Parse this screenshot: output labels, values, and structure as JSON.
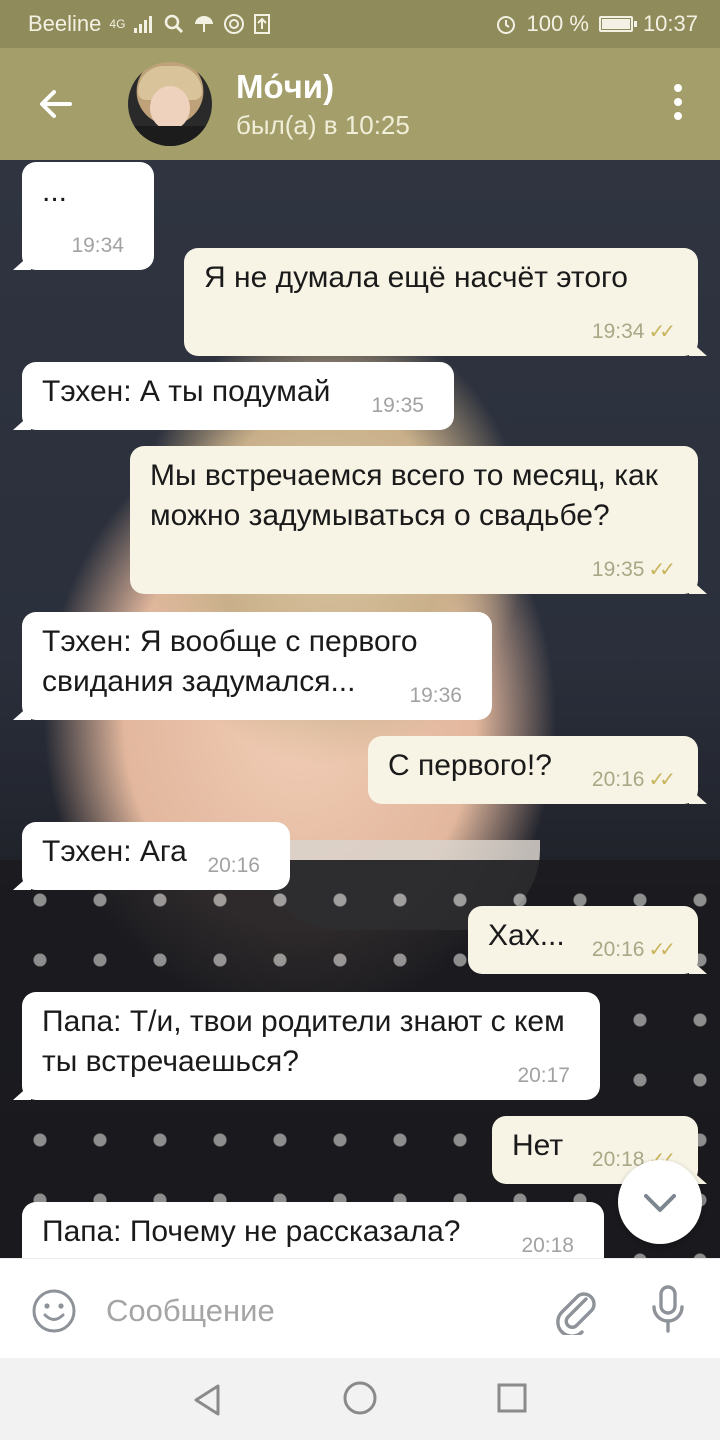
{
  "status_bar": {
    "carrier": "Beeline",
    "network": "4G",
    "battery_percent": "100 %",
    "time": "10:37",
    "icons": [
      "signal-icon",
      "search-icon",
      "umbrella-icon",
      "at-icon",
      "upload-icon",
      "alarm-icon",
      "battery-icon"
    ]
  },
  "header": {
    "contact_name": "Мо́чи)",
    "last_seen": "был(а) в 10:25",
    "back_icon": "arrow-left-icon",
    "menu_icon": "more-vertical-icon"
  },
  "messages": [
    {
      "direction": "in",
      "text": "...",
      "time": "19:34"
    },
    {
      "direction": "out",
      "text": "Я не думала ещё насчёт этого",
      "time": "19:34",
      "read": true
    },
    {
      "direction": "in",
      "text": "Тэхен: А ты подумай",
      "time": "19:35"
    },
    {
      "direction": "out",
      "text": "Мы встречаемся всего то месяц, как можно задумываться о свадьбе?",
      "time": "19:35",
      "read": true
    },
    {
      "direction": "in",
      "text": "Тэхен: Я вообще с первого свидания задумался...",
      "time": "19:36"
    },
    {
      "direction": "out",
      "text": "С первого!?",
      "time": "20:16",
      "read": true
    },
    {
      "direction": "in",
      "text": "Тэхен: Ага",
      "time": "20:16"
    },
    {
      "direction": "out",
      "text": "Хах...",
      "time": "20:16",
      "read": true
    },
    {
      "direction": "in",
      "text": "Папа: Т/и, твои родители знают с кем ты встречаешься?",
      "time": "20:17"
    },
    {
      "direction": "out",
      "text": "Нет",
      "time": "20:18",
      "read": true
    },
    {
      "direction": "in",
      "text": "Папа: Почему не рассказала?",
      "time": "20:18"
    }
  ],
  "input": {
    "placeholder": "Сообщение",
    "value": "",
    "emoji_icon": "smile-icon",
    "attach_icon": "paperclip-icon",
    "mic_icon": "microphone-icon"
  },
  "scroll_down_icon": "chevron-down-icon",
  "nav": {
    "icons": [
      "back-triangle-icon",
      "home-circle-icon",
      "recent-square-icon"
    ]
  },
  "colors": {
    "header": "#a39e6a",
    "status_bar": "#8f8b5a",
    "incoming_bubble": "#ffffff",
    "outgoing_bubble": "#f7f4e6",
    "read_check": "#c9b45c"
  }
}
